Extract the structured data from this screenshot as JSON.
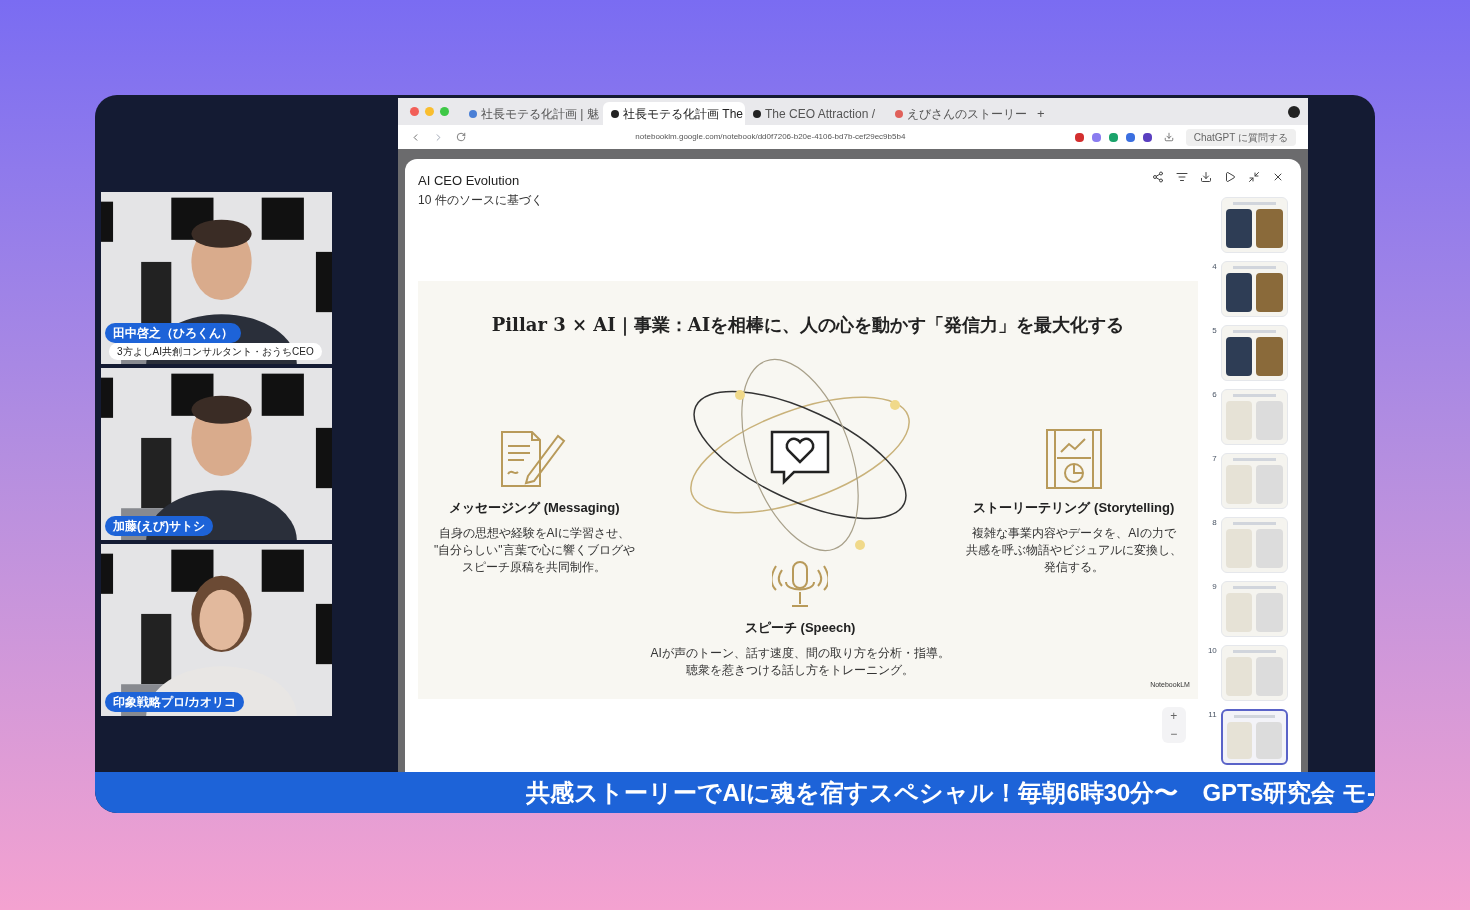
{
  "participants": [
    {
      "name": "田中啓之（ひろくん）",
      "role": "3方よしAI共創コンサルタント・おうちCEO"
    },
    {
      "name": "加藤(えび)サトシ"
    },
    {
      "name": "印象戦略プロ/カオリコ"
    }
  ],
  "browser": {
    "tabs": [
      {
        "label": "社長モテる化計画 | 魅",
        "selected": false,
        "color": "#4a7fd6"
      },
      {
        "label": "社長モテる化計画 The",
        "selected": true,
        "color": "#222222"
      },
      {
        "label": "The CEO Attraction /",
        "selected": false,
        "color": "#222222"
      },
      {
        "label": "えびさんのストーリー",
        "selected": false,
        "color": "#e0605a"
      }
    ],
    "new_tab": "+",
    "url": "notebooklm.google.com/notebook/dd0f7206-b20e-4106-bd7b-cef29ec9b5b4",
    "extension_button": "ChatGPT に質問する"
  },
  "notebook": {
    "title": "AI CEO Evolution",
    "subtitle": "10 件のソースに基づく",
    "slide": {
      "title": "Pillar 3 × AI｜事業：AIを相棒に、人の心を動かす「発信力」を最大化する",
      "pillars": [
        {
          "kind": "messaging",
          "heading": "メッセージング (Messaging)",
          "lines": [
            "自身の思想や経験をAIに学習させ、",
            "\"自分らしい\"言葉で心に響くブログや",
            "スピーチ原稿を共同制作。"
          ]
        },
        {
          "kind": "storytelling",
          "heading": "ストーリーテリング (Storytelling)",
          "lines": [
            "複雑な事業内容やデータを、AIの力で",
            "共感を呼ぶ物語やビジュアルに変換し、",
            "発信する。"
          ]
        },
        {
          "kind": "speech",
          "heading": "スピーチ (Speech)",
          "lines": [
            "AIが声のトーン、話す速度、間の取り方を分析・指導。",
            "聴衆を惹きつける話し方をトレーニング。"
          ]
        }
      ],
      "brand": "NotebookLM"
    },
    "zoom_in": "+",
    "zoom_out": "−",
    "thumbnails": [
      {
        "selected": false
      },
      {
        "number": "4",
        "selected": false
      },
      {
        "number": "5",
        "selected": false
      },
      {
        "number": "6",
        "selected": false
      },
      {
        "number": "7",
        "selected": false
      },
      {
        "number": "8",
        "selected": false
      },
      {
        "number": "9",
        "selected": false
      },
      {
        "number": "10",
        "selected": false
      },
      {
        "number": "11",
        "selected": true
      }
    ]
  },
  "ticker": "共感ストーリーでAIに魂を宿すスペシャル！毎朝6時30分〜　GPTs研究会 モ-"
}
